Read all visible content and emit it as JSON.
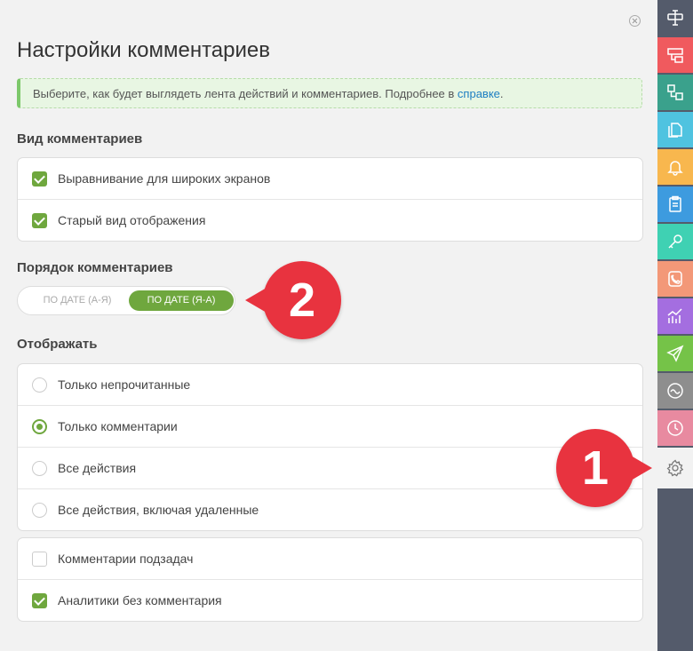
{
  "header": {
    "title": "Настройки комментариев"
  },
  "info": {
    "text": "Выберите, как будет выглядеть лента действий и комментариев. Подробнее в ",
    "link": "справке",
    "end": "."
  },
  "view_section": {
    "title": "Вид комментариев",
    "items": [
      {
        "label": "Выравнивание для широких экранов",
        "checked": true
      },
      {
        "label": "Старый вид отображения",
        "checked": true
      }
    ]
  },
  "order_section": {
    "title": "Порядок комментариев",
    "options": [
      "ПО ДАТЕ (А-Я)",
      "ПО ДАТЕ (Я-А)"
    ],
    "selected": "ПО ДАТЕ (Я-А)"
  },
  "display_section": {
    "title": "Отображать",
    "items": [
      {
        "label": "Только непрочитанные",
        "selected": false
      },
      {
        "label": "Только комментарии",
        "selected": true
      },
      {
        "label": "Все действия",
        "selected": false
      },
      {
        "label": "Все действия, включая удаленные",
        "selected": false
      }
    ]
  },
  "extra_section": {
    "items": [
      {
        "label": "Комментарии подзадач",
        "checked": false
      },
      {
        "label": "Аналитики без комментария",
        "checked": true
      }
    ]
  },
  "badges": {
    "one": "1",
    "two": "2"
  },
  "colors": {
    "accent": "#6fa73e",
    "badge": "#e8333f",
    "sidebar": "#545b6b"
  },
  "sidebar": {
    "items": [
      {
        "icon": "text-tool-icon",
        "color": "#545b6b"
      },
      {
        "icon": "layout-icon",
        "color": "#f05a5e"
      },
      {
        "icon": "tasks-tree-icon",
        "color": "#3aa18c"
      },
      {
        "icon": "documents-icon",
        "color": "#4fc3e0"
      },
      {
        "icon": "bell-icon",
        "color": "#f8b74e"
      },
      {
        "icon": "clipboard-icon",
        "color": "#3d9bdf"
      },
      {
        "icon": "key-icon",
        "color": "#3fd1b3"
      },
      {
        "icon": "phone-icon",
        "color": "#f39878"
      },
      {
        "icon": "analytics-icon",
        "color": "#a46ee0"
      },
      {
        "icon": "paper-plane-icon",
        "color": "#75c348"
      },
      {
        "icon": "wave-icon",
        "color": "#8e8e8e"
      },
      {
        "icon": "clock-icon",
        "color": "#e88aa0"
      },
      {
        "icon": "gear-icon",
        "color": "#f2f2f2"
      }
    ]
  }
}
